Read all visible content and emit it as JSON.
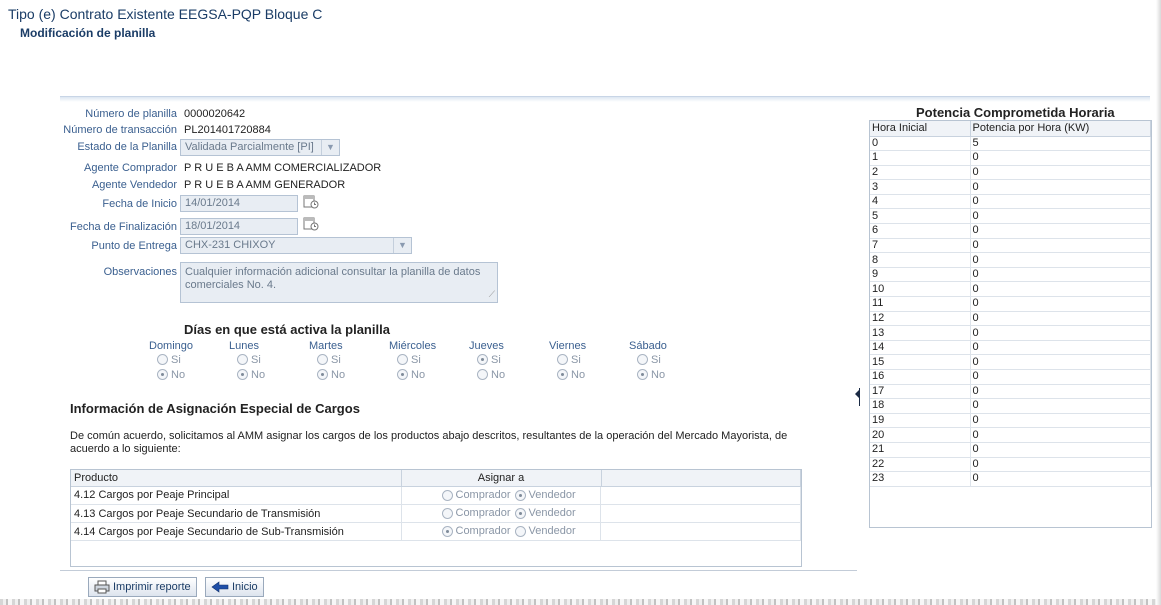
{
  "header": {
    "title": "Tipo (e) Contrato Existente EEGSA-PQP Bloque C",
    "subtitle": "Modificación de planilla"
  },
  "form": {
    "numero_planilla": {
      "label": "Número de planilla",
      "value": "0000020642"
    },
    "numero_transaccion": {
      "label": "Número de transacción",
      "value": "PL201401720884"
    },
    "estado": {
      "label": "Estado de la Planilla",
      "value": "Validada Parcialmente [PI]"
    },
    "agente_comprador": {
      "label": "Agente Comprador",
      "value": "P R U E B A AMM COMERCIALIZADOR"
    },
    "agente_vendedor": {
      "label": "Agente Vendedor",
      "value": "P R U E B A AMM GENERADOR"
    },
    "fecha_inicio": {
      "label": "Fecha de Inicio",
      "value": "14/01/2014"
    },
    "fecha_finalizacion": {
      "label": "Fecha de Finalización",
      "value": "18/01/2014"
    },
    "punto_entrega": {
      "label": "Punto de Entrega",
      "value": "CHX-231 CHIXOY"
    },
    "observaciones": {
      "label": "Observaciones",
      "value": "Cualquier información adicional consultar la planilla de datos comerciales No. 4."
    }
  },
  "days": {
    "title": "Días en que está activa la planilla",
    "si_label": "Si",
    "no_label": "No",
    "items": [
      {
        "name": "Domingo",
        "selected": "No"
      },
      {
        "name": "Lunes",
        "selected": "No"
      },
      {
        "name": "Martes",
        "selected": "No"
      },
      {
        "name": "Miércoles",
        "selected": "No"
      },
      {
        "name": "Jueves",
        "selected": "Si"
      },
      {
        "name": "Viernes",
        "selected": "No"
      },
      {
        "name": "Sábado",
        "selected": "No"
      }
    ]
  },
  "cargos": {
    "title": "Información de Asignación Especial de Cargos",
    "description": "De común acuerdo, solicitamos al AMM asignar los cargos de los productos abajo descritos, resultantes de la operación del Mercado Mayorista, de acuerdo a lo siguiente:",
    "col_producto": "Producto",
    "col_asignar": "Asignar a",
    "opt_comprador": "Comprador",
    "opt_vendedor": "Vendedor",
    "rows": [
      {
        "producto": "4.12 Cargos por Peaje Principal",
        "asignado": "Vendedor"
      },
      {
        "producto": "4.13 Cargos por Peaje Secundario de Transmisión",
        "asignado": "Vendedor"
      },
      {
        "producto": "4.14 Cargos por Peaje Secundario de Sub-Transmisión",
        "asignado": "Comprador"
      }
    ]
  },
  "buttons": {
    "imprimir": "Imprimir reporte",
    "inicio": "Inicio"
  },
  "potencia": {
    "title": "Potencia Comprometida Horaria",
    "col_hora": "Hora Inicial",
    "col_potencia": "Potencia por Hora (KW)",
    "rows": [
      {
        "hora": "0",
        "kw": "5"
      },
      {
        "hora": "1",
        "kw": "0"
      },
      {
        "hora": "2",
        "kw": "0"
      },
      {
        "hora": "3",
        "kw": "0"
      },
      {
        "hora": "4",
        "kw": "0"
      },
      {
        "hora": "5",
        "kw": "0"
      },
      {
        "hora": "6",
        "kw": "0"
      },
      {
        "hora": "7",
        "kw": "0"
      },
      {
        "hora": "8",
        "kw": "0"
      },
      {
        "hora": "9",
        "kw": "0"
      },
      {
        "hora": "10",
        "kw": "0"
      },
      {
        "hora": "11",
        "kw": "0"
      },
      {
        "hora": "12",
        "kw": "0"
      },
      {
        "hora": "13",
        "kw": "0"
      },
      {
        "hora": "14",
        "kw": "0"
      },
      {
        "hora": "15",
        "kw": "0"
      },
      {
        "hora": "16",
        "kw": "0"
      },
      {
        "hora": "17",
        "kw": "0"
      },
      {
        "hora": "18",
        "kw": "0"
      },
      {
        "hora": "19",
        "kw": "0"
      },
      {
        "hora": "20",
        "kw": "0"
      },
      {
        "hora": "21",
        "kw": "0"
      },
      {
        "hora": "22",
        "kw": "0"
      },
      {
        "hora": "23",
        "kw": "0"
      }
    ]
  },
  "colors": {
    "title": "#1a3c66",
    "label": "#3a5f8f",
    "readonly_bg": "#e8edf3"
  }
}
